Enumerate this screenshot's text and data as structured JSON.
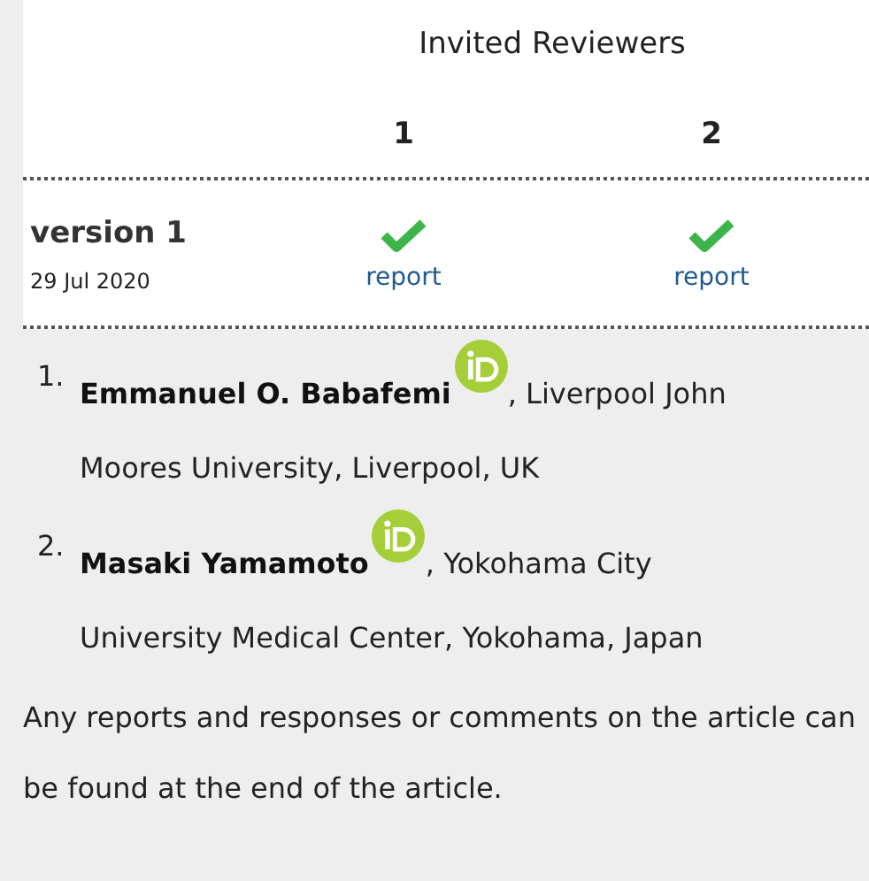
{
  "table": {
    "heading": "Invited Reviewers",
    "columns": [
      "1",
      "2"
    ],
    "rows": [
      {
        "version": "version 1",
        "date": "29 Jul 2020",
        "reviews": [
          {
            "approved": true,
            "link": "report"
          },
          {
            "approved": true,
            "link": "report"
          }
        ]
      }
    ]
  },
  "reviewers": [
    {
      "number": "1.",
      "name": "Emmanuel O. Babafemi",
      "orcid": true,
      "affiliation_lines": [
        ", Liverpool John",
        "Moores University, Liverpool, UK"
      ]
    },
    {
      "number": "2.",
      "name": "Masaki Yamamoto",
      "orcid": true,
      "affiliation_lines": [
        ", Yokohama City",
        "University Medical Center, Yokohama, Japan"
      ]
    }
  ],
  "note": "Any reports and responses or comments on the article can be found at the end of the article."
}
